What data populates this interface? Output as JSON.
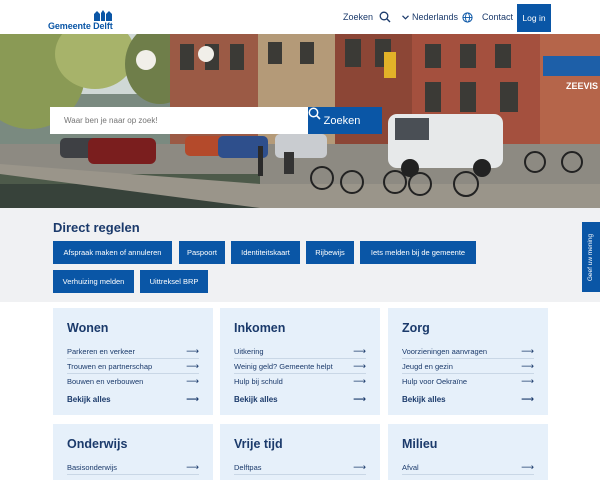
{
  "header": {
    "logo_text": "Gemeente Delft",
    "search_label": "Zoeken",
    "language_label": "Nederlands",
    "contact_label": "Contact",
    "login_label": "Log in"
  },
  "hero": {
    "search_placeholder": "Waar ben je naar op zoek!",
    "search_button": "Zoeken",
    "shop_sign": "ZEEVIS"
  },
  "direct": {
    "title": "Direct regelen",
    "chips": [
      "Afspraak maken of annuleren",
      "Paspoort",
      "Identiteitskaart",
      "Rijbewijs",
      "Iets melden bij de gemeente",
      "Verhuizing melden",
      "Uittreksel BRP"
    ]
  },
  "feedback_label": "Geef uw mening",
  "cards": [
    {
      "title": "Wonen",
      "links": [
        "Parkeren en verkeer",
        "Trouwen en partnerschap",
        "Bouwen en verbouwen"
      ],
      "more": "Bekijk alles"
    },
    {
      "title": "Inkomen",
      "links": [
        "Uitkering",
        "Weinig geld? Gemeente helpt",
        "Hulp bij schuld"
      ],
      "more": "Bekijk alles"
    },
    {
      "title": "Zorg",
      "links": [
        "Voorzieningen aanvragen",
        "Jeugd en gezin",
        "Hulp voor Oekraïne"
      ],
      "more": "Bekijk alles"
    },
    {
      "title": "Onderwijs",
      "links": [
        "Basisonderwijs"
      ]
    },
    {
      "title": "Vrije tijd",
      "links": [
        "Delftpas"
      ]
    },
    {
      "title": "Milieu",
      "links": [
        "Afval"
      ]
    }
  ],
  "colors": {
    "brand": "#0a56a6",
    "text": "#1b3a6b",
    "card_bg": "#e6f0fa",
    "section_bg": "#f0f1f3"
  }
}
